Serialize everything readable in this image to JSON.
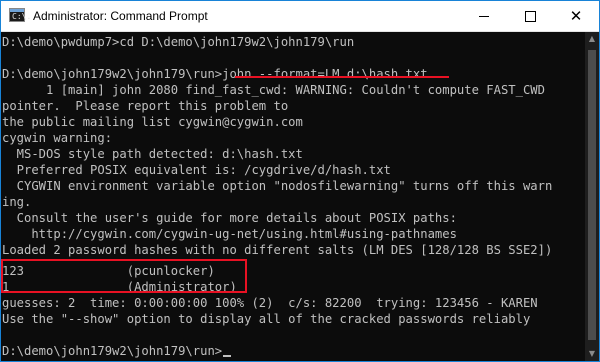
{
  "window": {
    "title": "Administrator: Command Prompt",
    "icon_text": "C:\\."
  },
  "controls": {
    "minimize": "minimize",
    "maximize": "maximize",
    "close": "✕"
  },
  "console": {
    "lines": [
      "D:\\demo\\pwdump7>cd D:\\demo\\john179w2\\john179\\run",
      "",
      "D:\\demo\\john179w2\\john179\\run>john --format=LM d:\\hash.txt",
      "      1 [main] john 2080 find_fast_cwd: WARNING: Couldn't compute FAST_CWD",
      "pointer.  Please report this problem to",
      "the public mailing list cygwin@cygwin.com",
      "cygwin warning:",
      "  MS-DOS style path detected: d:\\hash.txt",
      "  Preferred POSIX equivalent is: /cygdrive/d/hash.txt",
      "  CYGWIN environment variable option \"nodosfilewarning\" turns off this warn",
      "ing.",
      "  Consult the user's guide for more details about POSIX paths:",
      "    http://cygwin.com/cygwin-ug-net/using.html#using-pathnames",
      "Loaded 2 password hashes with no different salts (LM DES [128/128 BS SSE2])",
      "",
      "123              (pcunlocker)",
      "1                (Administrator)",
      "guesses: 2  time: 0:00:00:00 100% (2)  c/s: 82200  trying: 123456 - KAREN",
      "Use the \"--show\" option to display all of the cracked passwords reliably",
      "",
      "D:\\demo\\john179w2\\john179\\run>"
    ]
  },
  "colors": {
    "console_bg": "#0c0c0c",
    "console_text": "#c0c0c0",
    "highlight": "#e81123",
    "accent_border": "#1883d7"
  }
}
